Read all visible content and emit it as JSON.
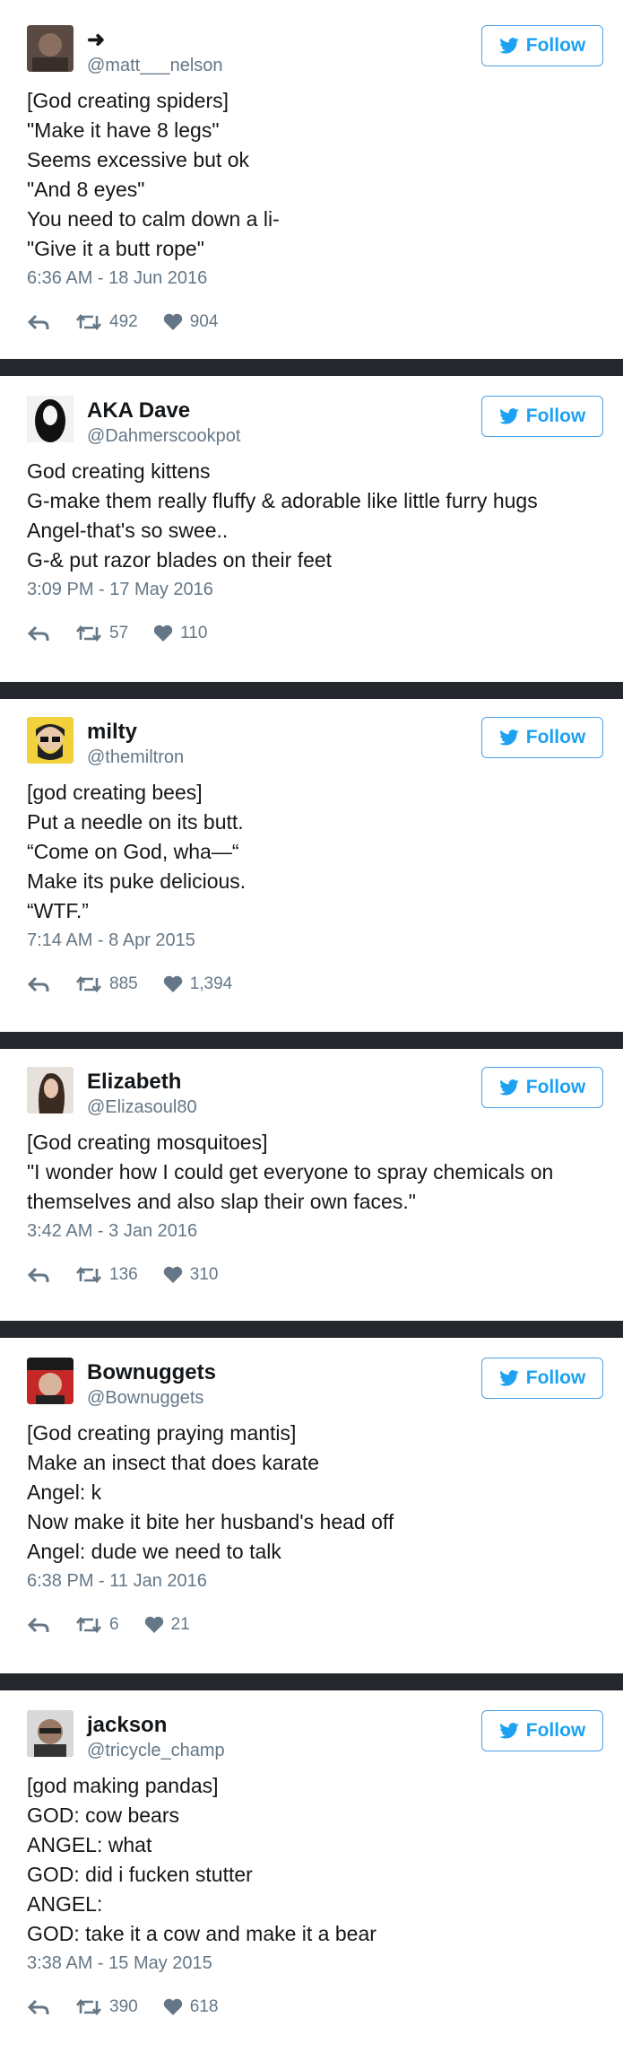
{
  "follow_label": "Follow",
  "colors": {
    "link_blue": "#1da1f2",
    "separator": "#24272b",
    "muted": "#657786"
  },
  "tweets": [
    {
      "name": "➜",
      "handle": "@matt___nelson",
      "lines": [
        "[God creating spiders]",
        "\"Make it have 8 legs\"",
        "Seems excessive but ok",
        "\"And 8 eyes\"",
        "You need to calm down a li-",
        "\"Give it a butt rope\""
      ],
      "time": "6:36 AM - 18 Jun 2016",
      "retweets": "492",
      "likes": "904"
    },
    {
      "name": "AKA Dave",
      "handle": "@Dahmerscookpot",
      "lines": [
        "God creating kittens",
        "G-make them really fluffy & adorable like little furry hugs",
        "Angel-that's so swee..",
        "G-& put razor blades on their feet"
      ],
      "time": "3:09 PM - 17 May 2016",
      "retweets": "57",
      "likes": "110"
    },
    {
      "name": "milty",
      "handle": "@themiltron",
      "lines": [
        "[god creating bees]",
        "Put a needle on its butt.",
        "“Come on God, wha—“",
        "Make its puke delicious.",
        "“WTF.”"
      ],
      "time": "7:14 AM - 8 Apr 2015",
      "retweets": "885",
      "likes": "1,394"
    },
    {
      "name": "Elizabeth",
      "handle": "@Elizasoul80",
      "lines": [
        "[God creating mosquitoes]",
        "\"I wonder how I could get everyone to spray chemicals on",
        "themselves and also slap their own faces.\""
      ],
      "time": "3:42 AM - 3 Jan 2016",
      "retweets": "136",
      "likes": "310"
    },
    {
      "name": "Bownuggets",
      "handle": "@Bownuggets",
      "lines": [
        "[God creating praying mantis]",
        "Make an insect that does karate",
        "Angel: k",
        "Now make it bite her husband's head off",
        "Angel: dude we need to talk"
      ],
      "time": "6:38 PM - 11 Jan 2016",
      "retweets": "6",
      "likes": "21"
    },
    {
      "name": "jackson",
      "handle": "@tricycle_champ",
      "lines": [
        "[god making pandas]",
        "GOD: cow bears",
        "ANGEL: what",
        "GOD: did i fucken stutter",
        "ANGEL:",
        "GOD: take it a cow and make it a bear"
      ],
      "time": "3:38 AM - 15 May 2015",
      "retweets": "390",
      "likes": "618"
    }
  ]
}
